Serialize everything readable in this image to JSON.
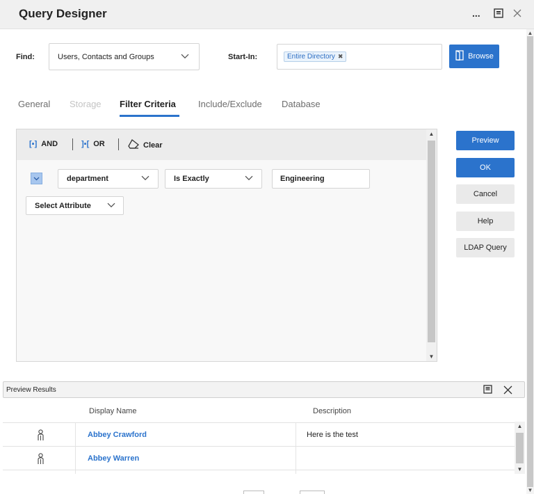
{
  "window": {
    "title": "Query Designer",
    "more_label": "...",
    "restore_icon": "restore-icon",
    "close_icon": "close-icon"
  },
  "find": {
    "label": "Find:",
    "value": "Users, Contacts and Groups"
  },
  "start_in": {
    "label": "Start-In:",
    "tag": "Entire Directory",
    "tag_remove": "✖"
  },
  "browse_button": {
    "label": "Browse",
    "icon": "folder-icon"
  },
  "tabs": [
    {
      "label": "General",
      "state": "normal"
    },
    {
      "label": "Storage",
      "state": "disabled"
    },
    {
      "label": "Filter Criteria",
      "state": "active"
    },
    {
      "label": "Include/Exclude",
      "state": "normal"
    },
    {
      "label": "Database",
      "state": "normal"
    }
  ],
  "filter_toolbar": {
    "and_label": "AND",
    "or_label": "OR",
    "clear_label": "Clear",
    "and_icon_text": "[▪]",
    "or_icon_text": "]▪[",
    "clear_icon": "eraser-icon"
  },
  "criteria": {
    "attribute": "department",
    "operator": "Is Exactly",
    "value": "Engineering",
    "select_attribute": "Select Attribute"
  },
  "side_buttons": {
    "preview": "Preview",
    "ok": "OK",
    "cancel": "Cancel",
    "help": "Help",
    "ldap": "LDAP Query"
  },
  "preview_results": {
    "title": "Preview Results",
    "columns": {
      "display_name": "Display Name",
      "description": "Description"
    },
    "rows": [
      {
        "name": "Abbey Crawford",
        "description": "Here is the test"
      },
      {
        "name": "Abbey Warren",
        "description": ""
      }
    ]
  },
  "colors": {
    "accent": "#2b73cc",
    "checkbox": "#a7c6ee",
    "tag_bg": "#eaf3fc"
  }
}
